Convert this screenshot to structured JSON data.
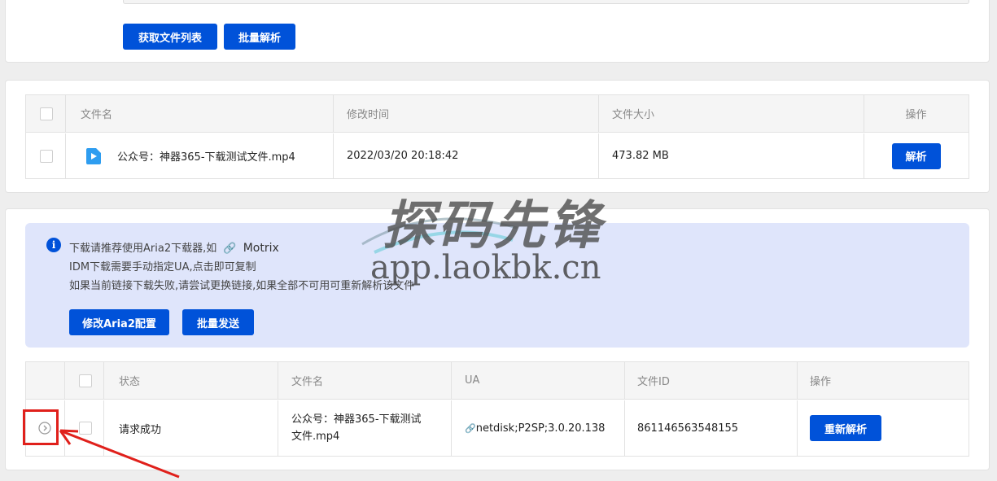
{
  "actions": {
    "get_list": "获取文件列表",
    "batch_parse": "批量解析"
  },
  "files_table": {
    "headers": [
      "文件名",
      "修改时间",
      "文件大小",
      "操作"
    ],
    "rows": [
      {
        "name": "公众号：神器365-下载测试文件.mp4",
        "modified": "2022/03/20 20:18:42",
        "size": "473.82 MB",
        "action": "解析"
      }
    ]
  },
  "notice": {
    "line1_prefix": "下载请推荐使用Aria2下载器,如",
    "line1_link": "Motrix",
    "line2": "IDM下载需要手动指定UA,点击即可复制",
    "line3": "如果当前链接下载失败,请尝试更换链接,如果全部不可用可重新解析该文件",
    "btn_aria2": "修改Aria2配置",
    "btn_batch_send": "批量发送"
  },
  "results_table": {
    "headers": [
      "状态",
      "文件名",
      "UA",
      "文件ID",
      "操作"
    ],
    "rows": [
      {
        "status": "请求成功",
        "name_line1": "公众号：神器365-下载测试",
        "name_line2": "文件.mp4",
        "ua": "netdisk;P2SP;3.0.20.138",
        "file_id": "861146563548155",
        "action": "重新解析"
      }
    ]
  },
  "watermark": {
    "brand": "探码先锋",
    "url": "app.laokbk.cn"
  },
  "colors": {
    "primary": "#0052d9",
    "notice_bg": "#dfe5fb",
    "highlight": "#e0201b"
  }
}
